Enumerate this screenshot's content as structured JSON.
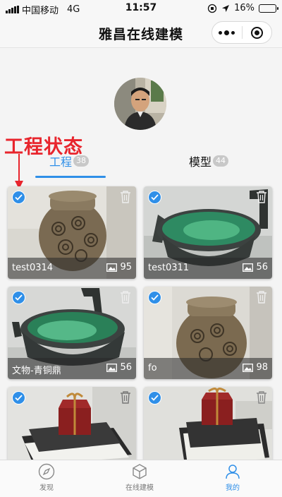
{
  "status_bar": {
    "carrier": "中国移动",
    "network": "4G",
    "time": "11:57",
    "battery": "16%",
    "battery_level": 0.16
  },
  "nav": {
    "title": "雅昌在线建模"
  },
  "annotation": {
    "text": "工程状态",
    "color": "#e8252d"
  },
  "tabs": [
    {
      "label": "工程",
      "count": "38",
      "active": true
    },
    {
      "label": "模型",
      "count": "44",
      "active": false
    }
  ],
  "projects": [
    {
      "name": "test0314",
      "count": "95",
      "checked": true
    },
    {
      "name": "test0311",
      "count": "56",
      "checked": true
    },
    {
      "name": "文物-青铜鼎",
      "count": "56",
      "checked": true
    },
    {
      "name": "fo",
      "count": "98",
      "checked": true
    },
    {
      "name": "",
      "count": "",
      "checked": true
    },
    {
      "name": "",
      "count": "",
      "checked": true
    }
  ],
  "tabbar": {
    "discover": "发现",
    "online_modeling": "在线建模",
    "mine": "我的"
  },
  "colors": {
    "accent": "#2f8fe8",
    "annotation_red": "#e8252d",
    "battery": "#f5c400"
  }
}
